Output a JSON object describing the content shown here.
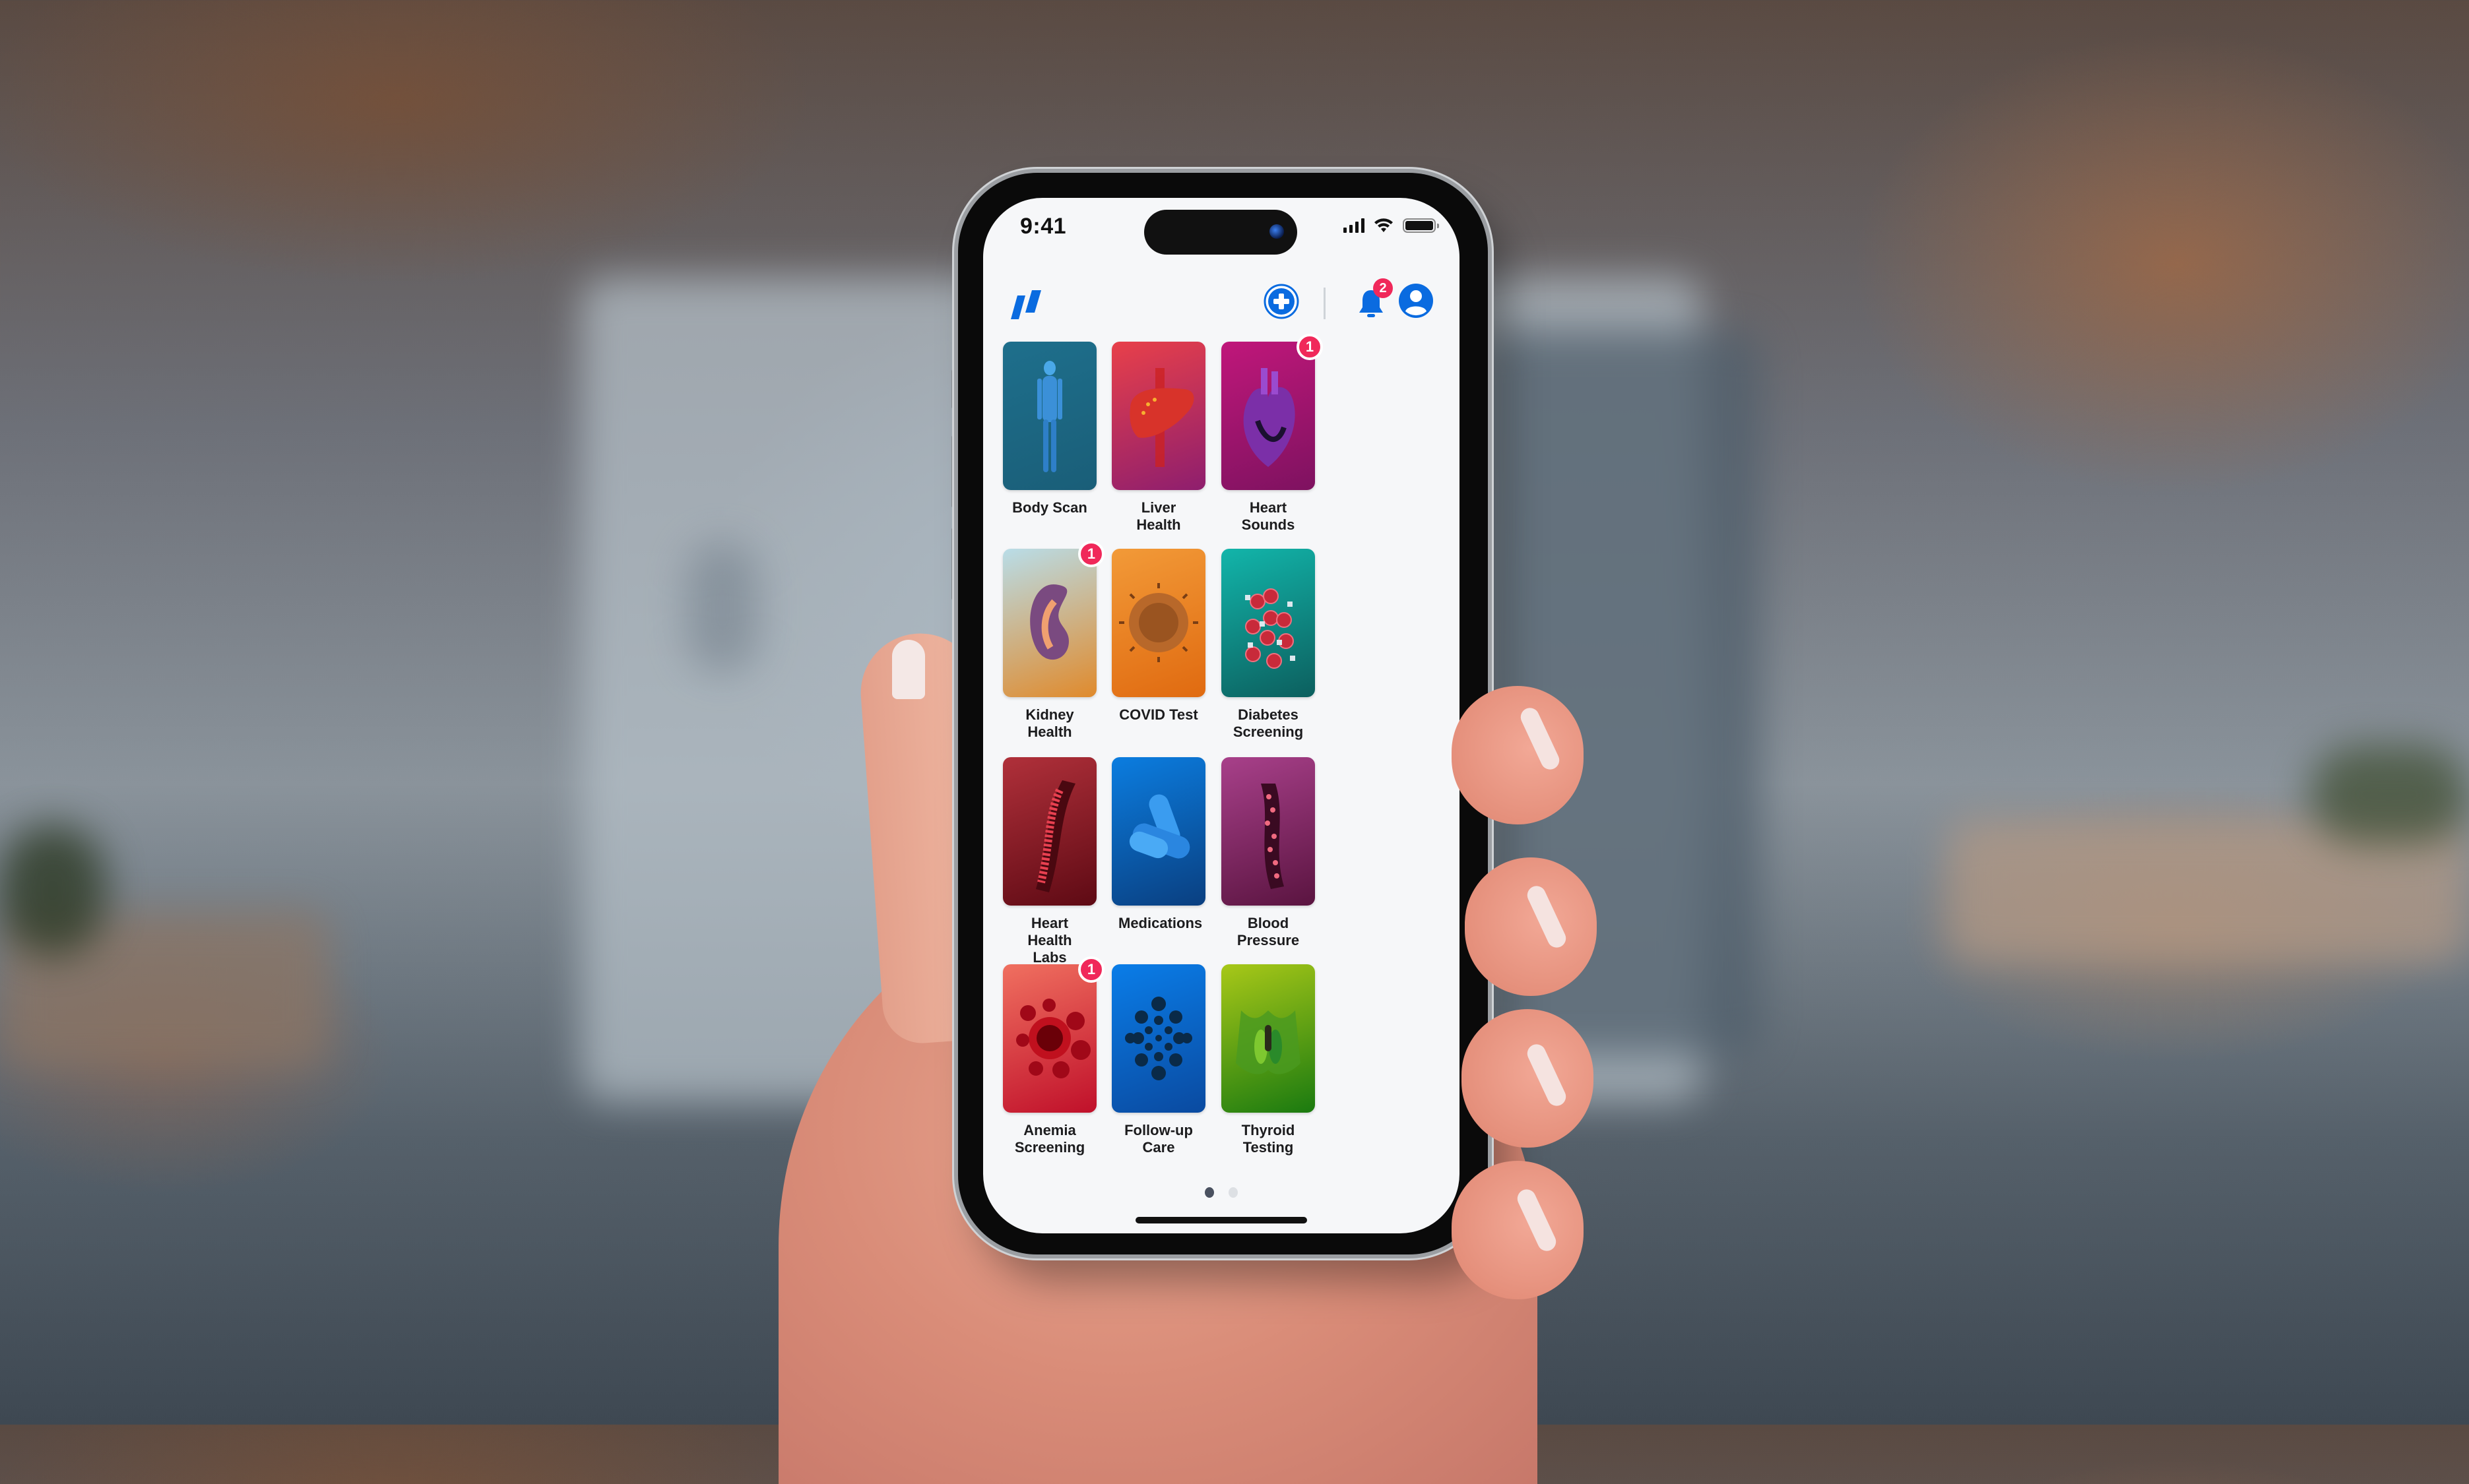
{
  "status_bar": {
    "time": "9:41",
    "icons": [
      "cellular-signal-icon",
      "wifi-icon",
      "battery-icon"
    ]
  },
  "header": {
    "logo": "app-logo-double-slash",
    "actions": [
      {
        "name": "add-medical-button",
        "icon": "plus-circle-icon"
      },
      {
        "name": "notifications-button",
        "icon": "bell-icon",
        "badge": "2"
      },
      {
        "name": "profile-button",
        "icon": "user-circle-icon"
      }
    ]
  },
  "colors": {
    "accent": "#0a6be0",
    "badge": "#f0285a",
    "screen_bg": "#f6f7f9"
  },
  "tiles": [
    {
      "label": "Body Scan",
      "badge": null,
      "icon": "human-body-icon",
      "colors": [
        "#1e6f8c",
        "#1a5e78"
      ]
    },
    {
      "label": "Liver Health",
      "badge": null,
      "icon": "liver-icon",
      "colors": [
        "#e8404a",
        "#8e1e6e"
      ]
    },
    {
      "label": "Heart Sounds",
      "badge": "1",
      "icon": "heart-organ-icon",
      "colors": [
        "#c0177a",
        "#7e1260"
      ]
    },
    {
      "label": "Kidney Health",
      "badge": "1",
      "icon": "kidney-icon",
      "colors": [
        "#b9dde8",
        "#e08a2c"
      ]
    },
    {
      "label": "COVID Test",
      "badge": null,
      "icon": "virus-icon",
      "colors": [
        "#f29a38",
        "#e06a10"
      ]
    },
    {
      "label": "Diabetes Screening",
      "badge": null,
      "icon": "blood-cells-sugar-icon",
      "colors": [
        "#12b5aa",
        "#0c5f5e"
      ]
    },
    {
      "label": "Heart Health Labs",
      "badge": null,
      "icon": "artery-icon",
      "colors": [
        "#b0303a",
        "#5e0a14"
      ]
    },
    {
      "label": "Medications",
      "badge": null,
      "icon": "capsules-icon",
      "colors": [
        "#0b7de0",
        "#0a3f80"
      ]
    },
    {
      "label": "Blood Pressure",
      "badge": null,
      "icon": "blood-vessel-icon",
      "colors": [
        "#a8408a",
        "#5a1440"
      ]
    },
    {
      "label": "Anemia Screening",
      "badge": "1",
      "icon": "red-blood-cells-icon",
      "colors": [
        "#f07060",
        "#c0102a"
      ]
    },
    {
      "label": "Follow-up Care",
      "badge": null,
      "icon": "dots-cluster-icon",
      "colors": [
        "#0a7de8",
        "#0a4aa0"
      ]
    },
    {
      "label": "Thyroid Testing",
      "badge": null,
      "icon": "thyroid-icon",
      "colors": [
        "#a8c818",
        "#1a7a10"
      ]
    }
  ],
  "pagination": {
    "current": 1,
    "total": 2
  }
}
